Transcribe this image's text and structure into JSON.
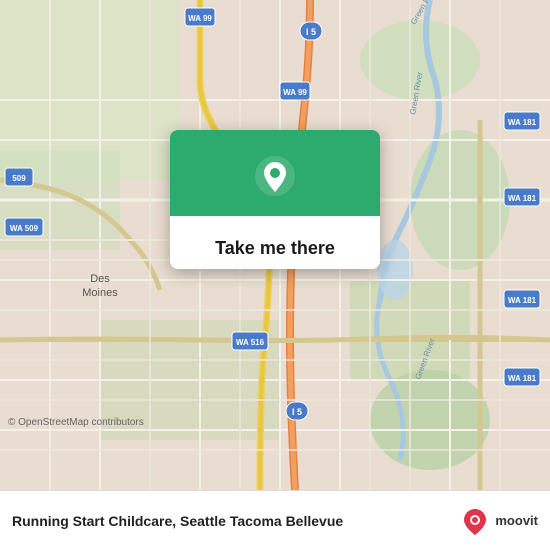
{
  "map": {
    "copyright": "© OpenStreetMap contributors",
    "background_color": "#e8e0d8"
  },
  "card": {
    "button_label": "Take me there",
    "pin_color": "#ffffff"
  },
  "bottom_bar": {
    "location_name": "Running Start Childcare, Seattle Tacoma Bellevue",
    "moovit_label": "moovit"
  },
  "route_labels": {
    "wa99_top": "WA 99",
    "wa99_center": "WA 99",
    "i5_top": "I 5",
    "i5_bottom": "I 5",
    "wa509_left": "509",
    "wa509_lower": "WA 509",
    "wa516": "WA 516",
    "wa181_1": "WA 181",
    "wa181_2": "WA 181",
    "wa181_3": "WA 181",
    "wa181_4": "WA 181",
    "des_moines": "Des\nMoines"
  }
}
